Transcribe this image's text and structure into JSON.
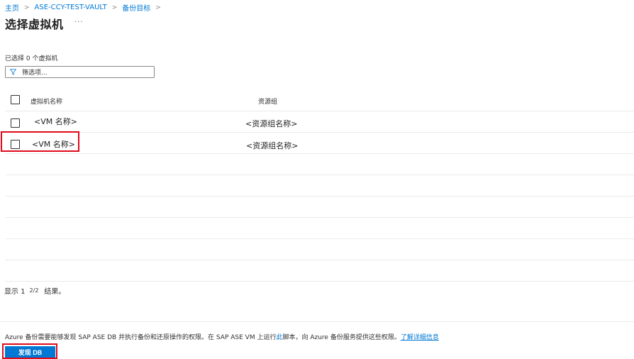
{
  "breadcrumb": {
    "items": [
      "主页",
      "ASE-CCY-TEST-VAULT",
      "备份目标"
    ],
    "separator": ">"
  },
  "page": {
    "title": "选择虚拟机",
    "more": "···"
  },
  "selection": {
    "count_text": "已选择 0 个虚拟机"
  },
  "filter": {
    "placeholder": "筛选项...",
    "icon": "filter-icon"
  },
  "grid": {
    "columns": [
      "虚拟机名称",
      "资源组"
    ],
    "rows": [
      {
        "vm_name": "<VM 名称>",
        "resource_group": "<资源组名称>",
        "checked": false
      },
      {
        "vm_name": "<VM 名称>",
        "resource_group": "<资源组名称>",
        "checked": false
      }
    ]
  },
  "pagination": {
    "prefix": "显示 1",
    "pager": "2/2",
    "suffix": "结果。"
  },
  "info": {
    "text_before": "Azure 备份需要能够发现 SAP ASE DB 并执行备份和还原操作的权限。在 SAP ASE VM 上运行",
    "script_link": "此",
    "text_after": "脚本，向 Azure 备份服务提供这些权限。",
    "learn_more": "了解详细信息"
  },
  "actions": {
    "discover_label": "发现 DB"
  },
  "colors": {
    "accent": "#0078d4",
    "highlight": "#e00b1c"
  }
}
